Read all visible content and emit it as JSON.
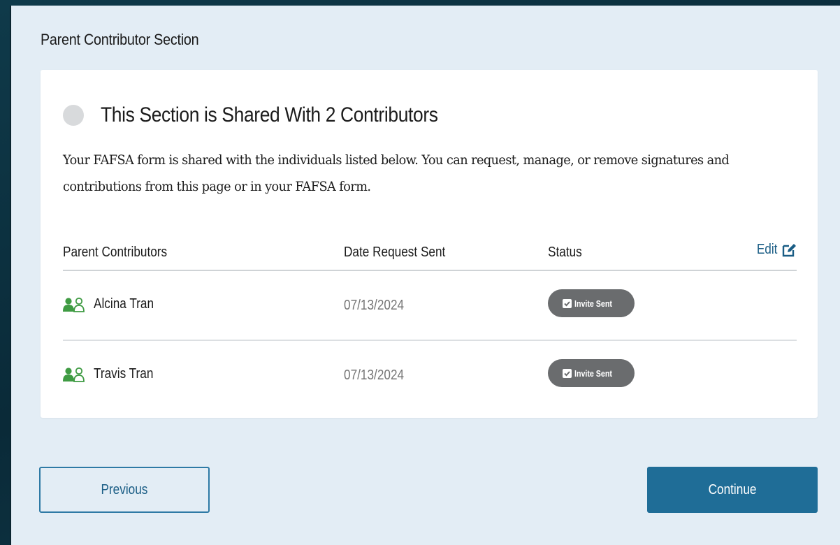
{
  "page": {
    "section_title": "Parent Contributor Section"
  },
  "card": {
    "heading": "This Section is Shared With 2 Contributors",
    "description": "Your FAFSA form is shared with the individuals listed below. You can request, manage, or remove signatures and contributions from this page or in your FAFSA form.",
    "status_dot_color": "#d8dadc"
  },
  "table": {
    "columns": {
      "name": "Parent Contributors",
      "date": "Date Request Sent",
      "status": "Status"
    },
    "edit_label": "Edit",
    "edit_icon": "edit-icon",
    "rows": [
      {
        "name": "Alcina Tran",
        "date": "07/13/2024",
        "status": "Invite Sent",
        "icon": "people-icon"
      },
      {
        "name": "Travis Tran",
        "date": "07/13/2024",
        "status": "Invite Sent",
        "icon": "people-icon"
      }
    ]
  },
  "buttons": {
    "previous": "Previous",
    "continue": "Continue"
  },
  "colors": {
    "accent": "#1f6d97",
    "link": "#1a5d85",
    "people_icon": "#3f9b43",
    "badge": "#6a6c6e",
    "background": "#e3edf5"
  }
}
